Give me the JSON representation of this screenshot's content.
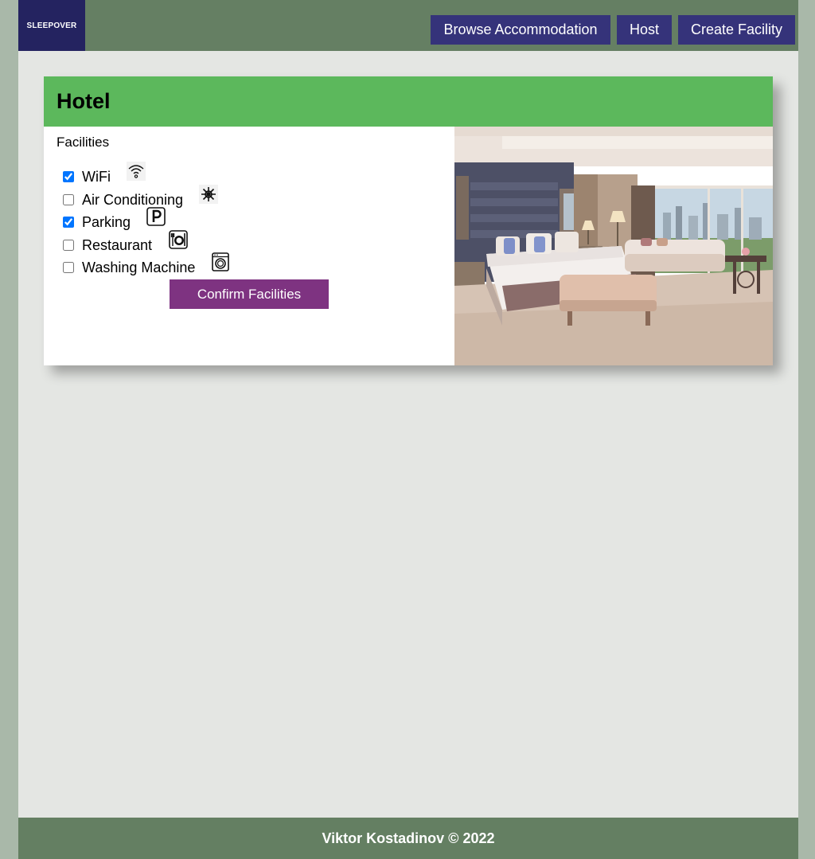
{
  "brand": {
    "logo_text": "SLEEPOVER"
  },
  "nav": {
    "browse_label": "Browse Accommodation",
    "host_label": "Host",
    "create_label": "Create Facility"
  },
  "card": {
    "title": "Hotel",
    "facilities_label": "Facilities",
    "facilities": [
      {
        "label": "WiFi",
        "checked": true,
        "icon": "wifi-icon"
      },
      {
        "label": "Air Conditioning",
        "checked": false,
        "icon": "air-conditioning-icon"
      },
      {
        "label": "Parking",
        "checked": true,
        "icon": "parking-icon"
      },
      {
        "label": "Restaurant",
        "checked": false,
        "icon": "restaurant-icon"
      },
      {
        "label": "Washing Machine",
        "checked": false,
        "icon": "washing-machine-icon"
      }
    ],
    "confirm_label": "Confirm Facilities",
    "image_alt": "hotel-room-photo"
  },
  "footer": {
    "text": "Viktor Kostadinov © 2022"
  },
  "colors": {
    "page_bg": "#e4e6e3",
    "side_bg": "#a9b8a9",
    "topbar": "#657f63",
    "logo_bg": "#242360",
    "nav_button": "#35337a",
    "card_header": "#5cb85c",
    "confirm_button": "#7e3381",
    "footer": "#647f62"
  }
}
